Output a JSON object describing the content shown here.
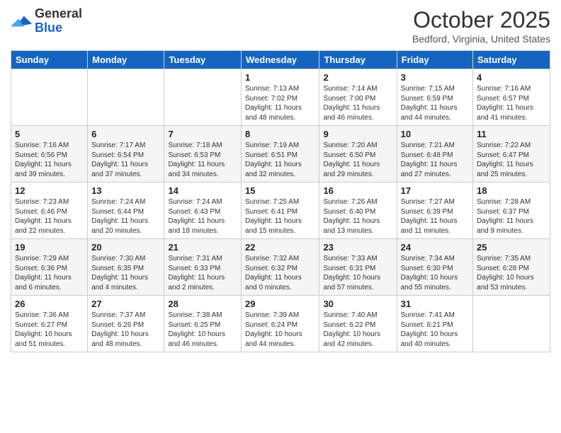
{
  "logo": {
    "general": "General",
    "blue": "Blue"
  },
  "title": "October 2025",
  "location": "Bedford, Virginia, United States",
  "days_of_week": [
    "Sunday",
    "Monday",
    "Tuesday",
    "Wednesday",
    "Thursday",
    "Friday",
    "Saturday"
  ],
  "weeks": [
    [
      {
        "day": "",
        "info": ""
      },
      {
        "day": "",
        "info": ""
      },
      {
        "day": "",
        "info": ""
      },
      {
        "day": "1",
        "info": "Sunrise: 7:13 AM\nSunset: 7:02 PM\nDaylight: 11 hours\nand 48 minutes."
      },
      {
        "day": "2",
        "info": "Sunrise: 7:14 AM\nSunset: 7:00 PM\nDaylight: 11 hours\nand 46 minutes."
      },
      {
        "day": "3",
        "info": "Sunrise: 7:15 AM\nSunset: 6:59 PM\nDaylight: 11 hours\nand 44 minutes."
      },
      {
        "day": "4",
        "info": "Sunrise: 7:16 AM\nSunset: 6:57 PM\nDaylight: 11 hours\nand 41 minutes."
      }
    ],
    [
      {
        "day": "5",
        "info": "Sunrise: 7:16 AM\nSunset: 6:56 PM\nDaylight: 11 hours\nand 39 minutes."
      },
      {
        "day": "6",
        "info": "Sunrise: 7:17 AM\nSunset: 6:54 PM\nDaylight: 11 hours\nand 37 minutes."
      },
      {
        "day": "7",
        "info": "Sunrise: 7:18 AM\nSunset: 6:53 PM\nDaylight: 11 hours\nand 34 minutes."
      },
      {
        "day": "8",
        "info": "Sunrise: 7:19 AM\nSunset: 6:51 PM\nDaylight: 11 hours\nand 32 minutes."
      },
      {
        "day": "9",
        "info": "Sunrise: 7:20 AM\nSunset: 6:50 PM\nDaylight: 11 hours\nand 29 minutes."
      },
      {
        "day": "10",
        "info": "Sunrise: 7:21 AM\nSunset: 6:48 PM\nDaylight: 11 hours\nand 27 minutes."
      },
      {
        "day": "11",
        "info": "Sunrise: 7:22 AM\nSunset: 6:47 PM\nDaylight: 11 hours\nand 25 minutes."
      }
    ],
    [
      {
        "day": "12",
        "info": "Sunrise: 7:23 AM\nSunset: 6:46 PM\nDaylight: 11 hours\nand 22 minutes."
      },
      {
        "day": "13",
        "info": "Sunrise: 7:24 AM\nSunset: 6:44 PM\nDaylight: 11 hours\nand 20 minutes."
      },
      {
        "day": "14",
        "info": "Sunrise: 7:24 AM\nSunset: 6:43 PM\nDaylight: 11 hours\nand 18 minutes."
      },
      {
        "day": "15",
        "info": "Sunrise: 7:25 AM\nSunset: 6:41 PM\nDaylight: 11 hours\nand 15 minutes."
      },
      {
        "day": "16",
        "info": "Sunrise: 7:26 AM\nSunset: 6:40 PM\nDaylight: 11 hours\nand 13 minutes."
      },
      {
        "day": "17",
        "info": "Sunrise: 7:27 AM\nSunset: 6:39 PM\nDaylight: 11 hours\nand 11 minutes."
      },
      {
        "day": "18",
        "info": "Sunrise: 7:28 AM\nSunset: 6:37 PM\nDaylight: 11 hours\nand 9 minutes."
      }
    ],
    [
      {
        "day": "19",
        "info": "Sunrise: 7:29 AM\nSunset: 6:36 PM\nDaylight: 11 hours\nand 6 minutes."
      },
      {
        "day": "20",
        "info": "Sunrise: 7:30 AM\nSunset: 6:35 PM\nDaylight: 11 hours\nand 4 minutes."
      },
      {
        "day": "21",
        "info": "Sunrise: 7:31 AM\nSunset: 6:33 PM\nDaylight: 11 hours\nand 2 minutes."
      },
      {
        "day": "22",
        "info": "Sunrise: 7:32 AM\nSunset: 6:32 PM\nDaylight: 11 hours\nand 0 minutes."
      },
      {
        "day": "23",
        "info": "Sunrise: 7:33 AM\nSunset: 6:31 PM\nDaylight: 10 hours\nand 57 minutes."
      },
      {
        "day": "24",
        "info": "Sunrise: 7:34 AM\nSunset: 6:30 PM\nDaylight: 10 hours\nand 55 minutes."
      },
      {
        "day": "25",
        "info": "Sunrise: 7:35 AM\nSunset: 6:28 PM\nDaylight: 10 hours\nand 53 minutes."
      }
    ],
    [
      {
        "day": "26",
        "info": "Sunrise: 7:36 AM\nSunset: 6:27 PM\nDaylight: 10 hours\nand 51 minutes."
      },
      {
        "day": "27",
        "info": "Sunrise: 7:37 AM\nSunset: 6:26 PM\nDaylight: 10 hours\nand 48 minutes."
      },
      {
        "day": "28",
        "info": "Sunrise: 7:38 AM\nSunset: 6:25 PM\nDaylight: 10 hours\nand 46 minutes."
      },
      {
        "day": "29",
        "info": "Sunrise: 7:39 AM\nSunset: 6:24 PM\nDaylight: 10 hours\nand 44 minutes."
      },
      {
        "day": "30",
        "info": "Sunrise: 7:40 AM\nSunset: 6:22 PM\nDaylight: 10 hours\nand 42 minutes."
      },
      {
        "day": "31",
        "info": "Sunrise: 7:41 AM\nSunset: 6:21 PM\nDaylight: 10 hours\nand 40 minutes."
      },
      {
        "day": "",
        "info": ""
      }
    ]
  ]
}
